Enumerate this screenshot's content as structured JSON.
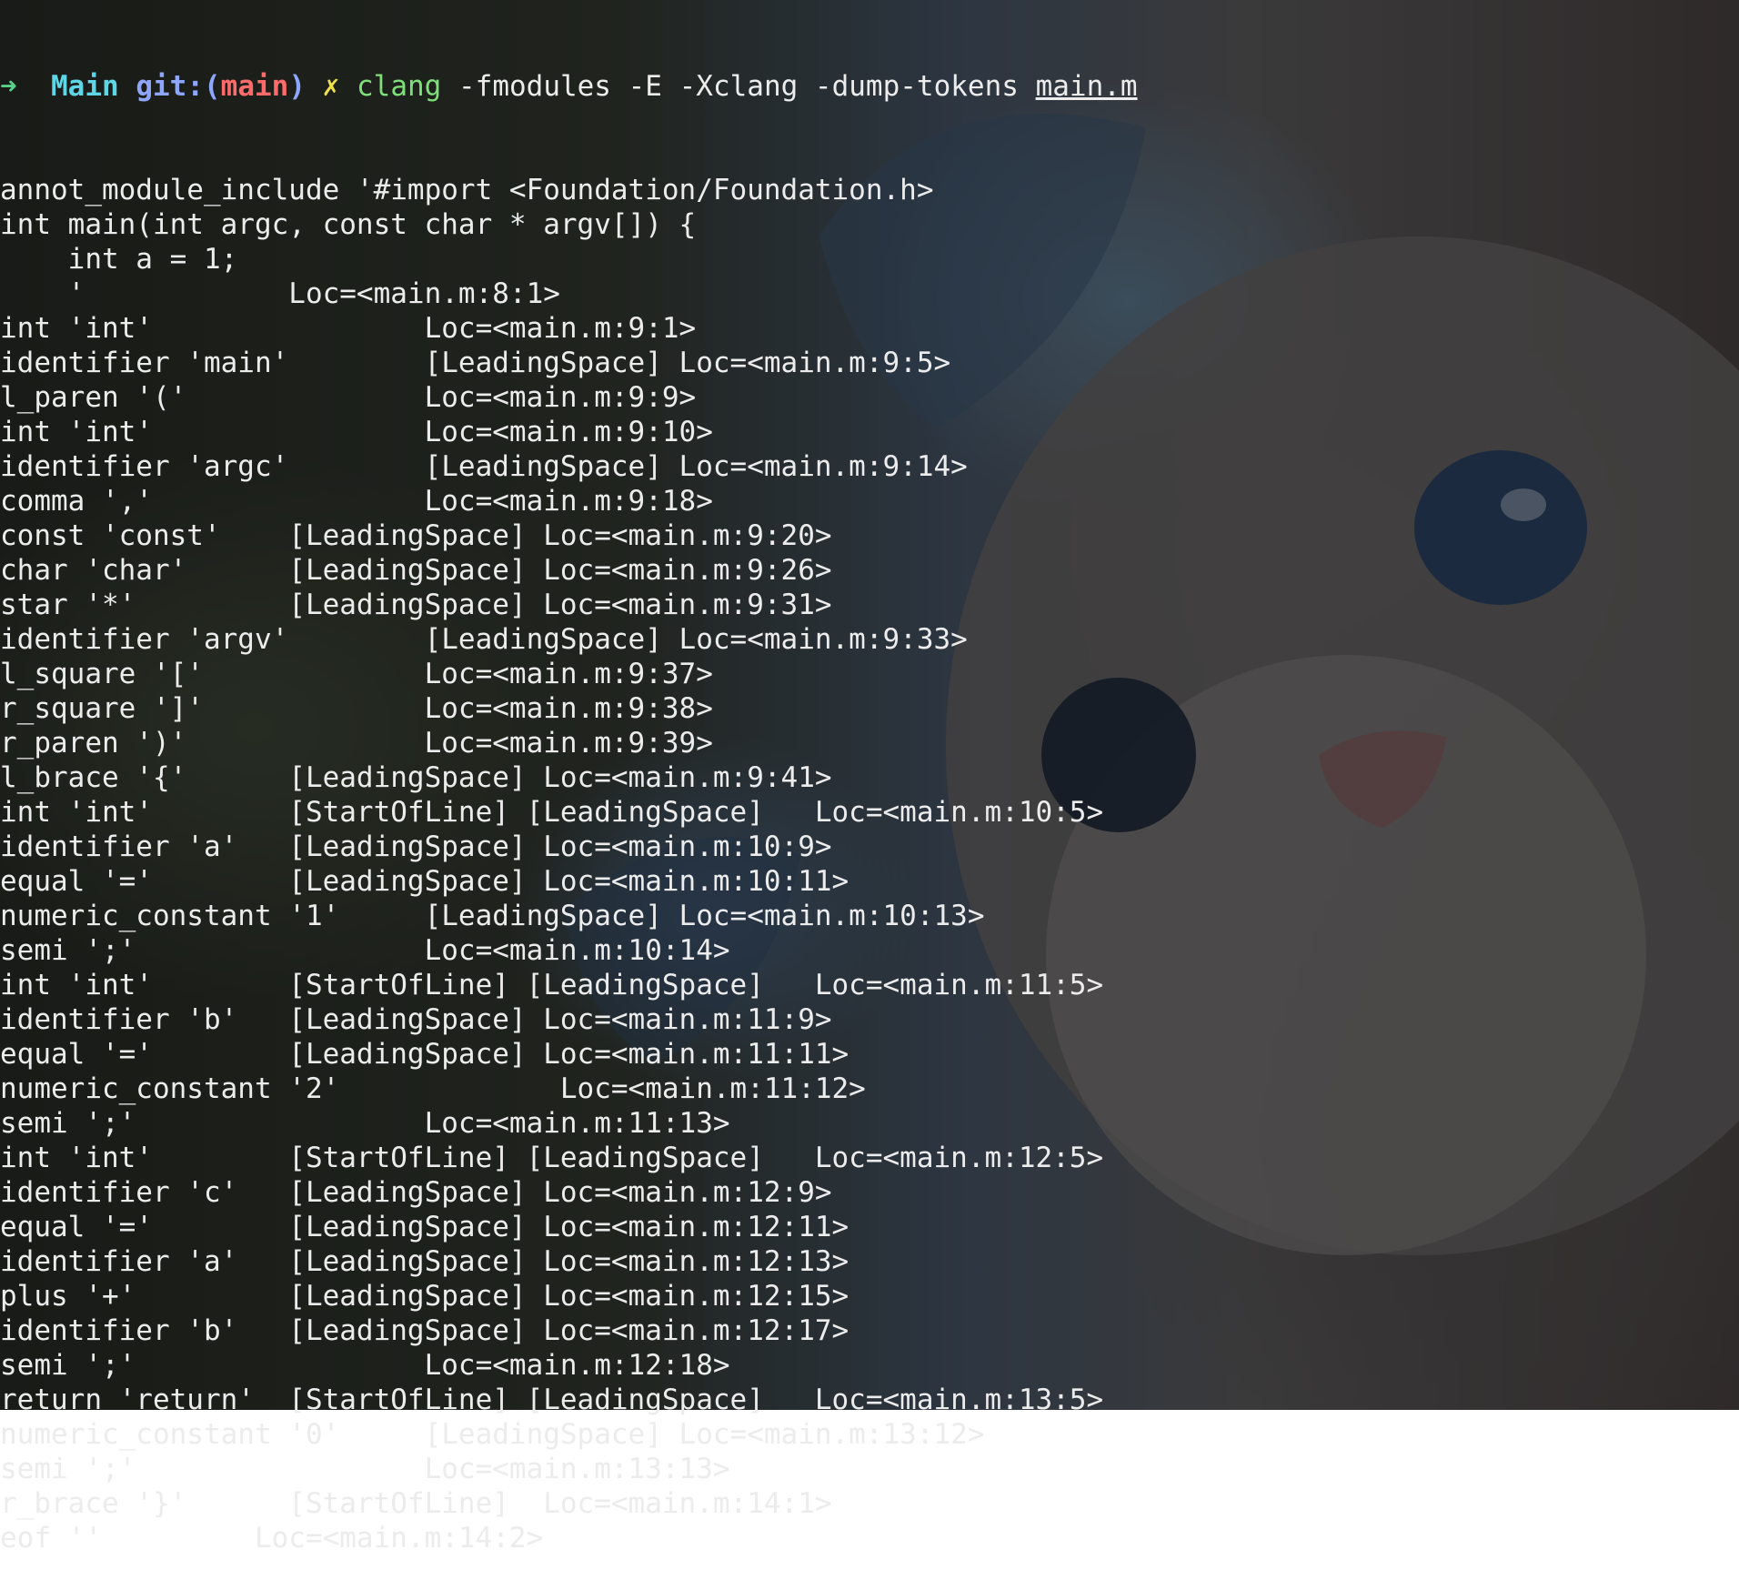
{
  "prompt": {
    "arrow": "➜",
    "directory": "Main",
    "git_label": "git:(",
    "branch": "main",
    "git_close": ")",
    "dirty_mark": "✗",
    "command": "clang",
    "args": "-fmodules -E -Xclang -dump-tokens",
    "file": "main.m"
  },
  "output_lines": [
    "annot_module_include '#import <Foundation/Foundation.h>",
    "int main(int argc, const char * argv[]) {",
    "    int a = 1;",
    "    '            Loc=<main.m:8:1>",
    "int 'int'                Loc=<main.m:9:1>",
    "identifier 'main'        [LeadingSpace] Loc=<main.m:9:5>",
    "l_paren '('              Loc=<main.m:9:9>",
    "int 'int'                Loc=<main.m:9:10>",
    "identifier 'argc'        [LeadingSpace] Loc=<main.m:9:14>",
    "comma ','                Loc=<main.m:9:18>",
    "const 'const'    [LeadingSpace] Loc=<main.m:9:20>",
    "char 'char'      [LeadingSpace] Loc=<main.m:9:26>",
    "star '*'         [LeadingSpace] Loc=<main.m:9:31>",
    "identifier 'argv'        [LeadingSpace] Loc=<main.m:9:33>",
    "l_square '['             Loc=<main.m:9:37>",
    "r_square ']'             Loc=<main.m:9:38>",
    "r_paren ')'              Loc=<main.m:9:39>",
    "l_brace '{'      [LeadingSpace] Loc=<main.m:9:41>",
    "int 'int'        [StartOfLine] [LeadingSpace]   Loc=<main.m:10:5>",
    "identifier 'a'   [LeadingSpace] Loc=<main.m:10:9>",
    "equal '='        [LeadingSpace] Loc=<main.m:10:11>",
    "numeric_constant '1'     [LeadingSpace] Loc=<main.m:10:13>",
    "semi ';'                 Loc=<main.m:10:14>",
    "int 'int'        [StartOfLine] [LeadingSpace]   Loc=<main.m:11:5>",
    "identifier 'b'   [LeadingSpace] Loc=<main.m:11:9>",
    "equal '='        [LeadingSpace] Loc=<main.m:11:11>",
    "numeric_constant '2'             Loc=<main.m:11:12>",
    "semi ';'                 Loc=<main.m:11:13>",
    "int 'int'        [StartOfLine] [LeadingSpace]   Loc=<main.m:12:5>",
    "identifier 'c'   [LeadingSpace] Loc=<main.m:12:9>",
    "equal '='        [LeadingSpace] Loc=<main.m:12:11>",
    "identifier 'a'   [LeadingSpace] Loc=<main.m:12:13>",
    "plus '+'         [LeadingSpace] Loc=<main.m:12:15>",
    "identifier 'b'   [LeadingSpace] Loc=<main.m:12:17>",
    "semi ';'                 Loc=<main.m:12:18>",
    "return 'return'  [StartOfLine] [LeadingSpace]   Loc=<main.m:13:5>",
    "numeric_constant '0'     [LeadingSpace] Loc=<main.m:13:12>",
    "semi ';'                 Loc=<main.m:13:13>",
    "r_brace '}'      [StartOfLine]  Loc=<main.m:14:1>",
    "eof ''         Loc=<main.m:14:2>"
  ],
  "colors": {
    "text": "#ececec",
    "arrow": "#58d08a",
    "directory": "#5ed6e6",
    "git": "#8fa6ff",
    "branch": "#ff6b6b",
    "dirty": "#f0e14a",
    "command": "#7fe07a"
  }
}
